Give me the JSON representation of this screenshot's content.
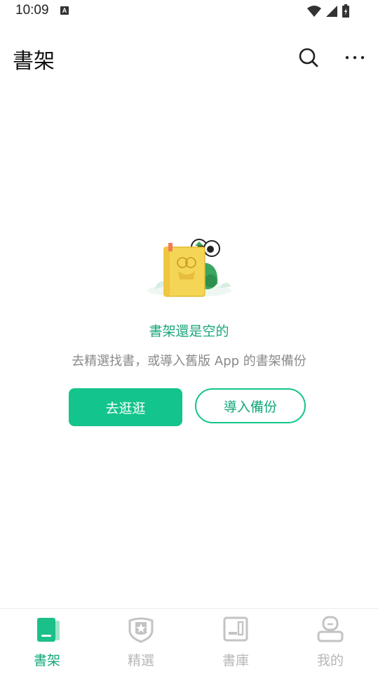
{
  "status_bar": {
    "time": "10:09",
    "notification_badge": "A"
  },
  "app_bar": {
    "title": "書架",
    "search_icon": "search-icon",
    "more_icon": "more-horizontal-icon"
  },
  "empty_state": {
    "illustration": "frog-with-book-illustration",
    "title": "書架還是空的",
    "description": "去精選找書，或導入舊版 App 的書架備份",
    "primary_button": "去逛逛",
    "secondary_button": "導入備份"
  },
  "tab_bar": {
    "items": [
      {
        "label": "書架",
        "icon": "bookshelf-icon",
        "active": true
      },
      {
        "label": "精選",
        "icon": "featured-badge-icon",
        "active": false
      },
      {
        "label": "書庫",
        "icon": "library-icon",
        "active": false
      },
      {
        "label": "我的",
        "icon": "profile-icon",
        "active": false
      }
    ]
  },
  "colors": {
    "accent": "#13c48c",
    "accent_text": "#13a77a",
    "inactive": "#b7b7b7"
  }
}
